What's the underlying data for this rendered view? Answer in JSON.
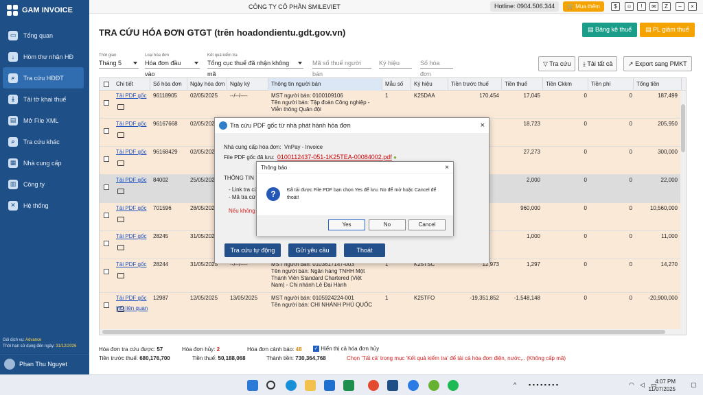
{
  "app": {
    "name": "GAM INVOICE",
    "company": "CÔNG TY CỔ PHẦN SMILEVIET",
    "hotline": "Hotline: 0904.506.344",
    "buy_label": "Mua thêm"
  },
  "sidebar": {
    "items": [
      {
        "label": "Tổng quan",
        "icon": "monitor-icon"
      },
      {
        "label": "Hòm thư nhận HĐ",
        "icon": "inbox-icon"
      },
      {
        "label": "Tra cứu HĐĐT",
        "icon": "search-icon",
        "active": true
      },
      {
        "label": "Tải tờ khai thuế",
        "icon": "download-icon"
      },
      {
        "label": "Mở File XML",
        "icon": "folder-icon"
      },
      {
        "label": "Tra cứu khác",
        "icon": "search-icon"
      },
      {
        "label": "Nhà cung cấp",
        "icon": "contacts-icon"
      },
      {
        "label": "Công ty",
        "icon": "building-icon"
      },
      {
        "label": "Hệ thống",
        "icon": "tools-icon"
      }
    ],
    "service_label": "Gói dịch vụ:",
    "service_value": "Advance",
    "expiry_label": "Thời hạn sử dụng đến ngày:",
    "expiry_value": "31/12/2026",
    "user_name": "Phan Thu Nguyet"
  },
  "page": {
    "title": "TRA CỨU HÓA ĐƠN GTGT (trên hoadondientu.gdt.gov.vn)",
    "btn_tax_table": "Bảng kê thuế",
    "btn_pdf_reduce": "PL giảm thuế"
  },
  "filters": {
    "period_label": "Thời gian",
    "period_value": "Tháng 5",
    "type_label": "Loại hóa đơn",
    "type_value": "Hóa đơn đầu vào",
    "result_label": "Kết quả kiểm tra",
    "result_value": "Tổng cục thuế đã nhận không mã",
    "tax_code_placeholder": "Mã số thuế người bán",
    "symbol_placeholder": "Ký hiệu",
    "invoice_no_placeholder": "Số hóa đơn",
    "search_btn": "Tra cứu",
    "download_all_btn": "Tải tất cả",
    "export_btn": "Export sang PMKT"
  },
  "table": {
    "headers": [
      "Chi tiết",
      "Số hóa đơn",
      "Ngày hóa đơn",
      "Ngày ký",
      "Thông tin người bán",
      "Mẫu số",
      "Ký hiệu",
      "Tiền trước thuế",
      "Tiền thuế",
      "Tiền Ckkm",
      "Tiền phí",
      "Tổng tiền"
    ],
    "link_label": "Tải PDF gốc",
    "rows": [
      {
        "no": "96118905",
        "date": "02/05/2025",
        "sign": "--/--/----",
        "seller": [
          "MST người bán: 0100109106",
          "Tên người bán: Tập đoàn Công nghiệp -",
          "Viễn thông Quân đội"
        ],
        "form": "1",
        "symbol": "K25DAA",
        "pre": "170,454",
        "tax": "17,045",
        "ck": "0",
        "fee": "0",
        "total": "187,499"
      },
      {
        "no": "96167668",
        "date": "02/05/2025",
        "sign": "",
        "seller": [],
        "form": "",
        "symbol": "",
        "pre": "",
        "tax": "18,723",
        "ck": "0",
        "fee": "0",
        "total": "205,950"
      },
      {
        "no": "96168429",
        "date": "02/05/2025",
        "sign": "",
        "seller": [],
        "form": "",
        "symbol": "",
        "pre": "",
        "tax": "27,273",
        "ck": "0",
        "fee": "0",
        "total": "300,000"
      },
      {
        "no": "84002",
        "date": "25/05/2025",
        "sign": "",
        "seller": [],
        "form": "",
        "symbol": "",
        "pre": "",
        "tax": "2,000",
        "ck": "0",
        "fee": "0",
        "total": "22,000"
      },
      {
        "no": "701596",
        "date": "28/05/2025",
        "sign": "",
        "seller": [],
        "form": "",
        "symbol": "",
        "pre": "",
        "tax": "960,000",
        "ck": "0",
        "fee": "0",
        "total": "10,560,000"
      },
      {
        "no": "28245",
        "date": "31/05/2025",
        "sign": "",
        "seller": [
          "Nam) - Chi nhánh Lê Đại Hành"
        ],
        "form": "",
        "symbol": "",
        "pre": "",
        "tax": "1,000",
        "ck": "0",
        "fee": "0",
        "total": "11,000"
      },
      {
        "no": "28244",
        "date": "31/05/2025",
        "sign": "--/--/----",
        "seller": [
          "MST người bán: 0103617147-003",
          "Tên người bán: Ngân hàng TNHH Một",
          "Thành Viên Standard Chartered (Việt",
          "Nam) - Chi nhánh Lê Đại Hành"
        ],
        "form": "1",
        "symbol": "K25TSC",
        "pre": "12,973",
        "tax": "1,297",
        "ck": "0",
        "fee": "0",
        "total": "14,270"
      },
      {
        "no": "12987",
        "date": "12/05/2025",
        "sign": "13/05/2025",
        "seller": [
          "MST người bán: 0105924224-001",
          "Tên người bán: CHI NHÁNH PHÚ QUỐC"
        ],
        "form": "1",
        "symbol": "K25TFO",
        "pre": "-19,351,852",
        "tax": "-1,548,148",
        "ck": "0",
        "fee": "0",
        "total": "-20,900,000"
      }
    ],
    "extra_link": "HĐ liên quan"
  },
  "summary": {
    "found_label": "Hóa đơn tra cứu được:",
    "found_value": "57",
    "cancel_label": "Hóa đơn hủy:",
    "cancel_value": "2",
    "warn_label": "Hóa đơn cảnh báo:",
    "warn_value": "48",
    "show_cancel_label": "Hiển thị cả hóa đơn hủy",
    "pre_label": "Tiền trước thuế:",
    "pre_value": "680,176,700",
    "tax_label": "Tiền thuế:",
    "tax_value": "50,188,068",
    "total_label": "Thành tiền:",
    "total_value": "730,364,768",
    "note": "Chọn 'Tất cả' trong mục 'Kết quả kiểm tra' để tải cả hóa đơn điện, nước,.. (Không cấp mã)"
  },
  "pdf_dialog": {
    "title": "Tra cứu PDF gốc từ nhà phát hành hóa đơn",
    "provider_label": "Nhà cung cấp hóa đơn:",
    "provider_value": "VnPay - Invoice",
    "file_label": "File PDF gốc đã lưu:",
    "file_value": "0100112437-051-1K25TEA-00084002.pdf",
    "info_label": "THÔNG TIN",
    "link_line": "- Link tra cứ",
    "code_line": "- Mã tra cứ",
    "warn_line": "Nếu không",
    "btn_auto": "Tra cứu tự động",
    "btn_request": "Gửi yêu cầu",
    "btn_exit": "Thoát"
  },
  "message_box": {
    "title": "Thông báo",
    "text": "Đã tải được File PDF bạn chọn Yes để lưu. No để mở hoặc Cancel để thoát!",
    "yes": "Yes",
    "no": "No",
    "cancel": "Cancel"
  },
  "taskbar": {
    "time": "4:07 PM",
    "date": "11/07/2025"
  }
}
